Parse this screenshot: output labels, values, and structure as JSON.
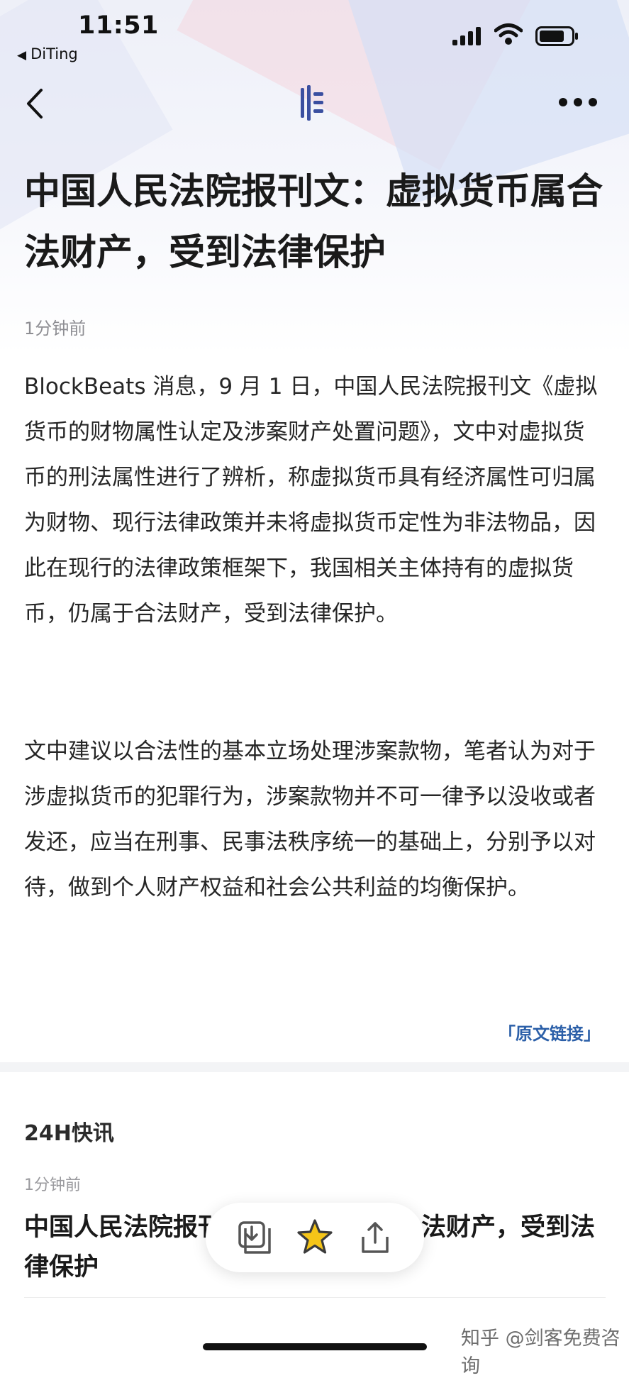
{
  "status_bar": {
    "time": "11:51",
    "back_app_label": "DiTing",
    "icons": [
      "cellular-signal-icon",
      "wifi-icon",
      "battery-icon"
    ]
  },
  "nav": {
    "icons": [
      "back-arrow-icon",
      "app-logo-icon",
      "more-options-icon"
    ]
  },
  "article": {
    "title": "中国人民法院报刊文：虚拟货币属合法财产，受到法律保护",
    "time": "1分钟前",
    "paragraphs": [
      "BlockBeats 消息，9 月 1 日，中国人民法院报刊文《虚拟货币的财物属性认定及涉案财产处置问题》，文中对虚拟货币的刑法属性进行了辨析，称虚拟货币具有经济属性可归属为财物、现行法律政策并未将虚拟货币定性为非法物品，因此在现行的法律政策框架下，我国相关主体持有的虚拟货币，仍属于合法财产，受到法律保护。",
      "文中建议以合法性的基本立场处理涉案款物，笔者认为对于涉虚拟货币的犯罪行为，涉案款物并不可一律予以没收或者发还，应当在刑事、民事法秩序统一的基础上，分别予以对待，做到个人财产权益和社会公共利益的均衡保护。"
    ],
    "source_link": "「原文链接」"
  },
  "news_section": {
    "title": "24H快讯",
    "items": [
      {
        "time": "1分钟前",
        "title": "中国人民法院报刊文：虚拟货币属合法财产，受到法律保护"
      }
    ]
  },
  "action_bar": {
    "icons": [
      "save-image-icon",
      "star-icon",
      "share-icon"
    ]
  },
  "watermark": "知乎 @剑客免费咨询",
  "colors": {
    "accent_link": "#2b5fa8",
    "star_fill": "#f5c518",
    "logo": "#3a4fa0"
  }
}
